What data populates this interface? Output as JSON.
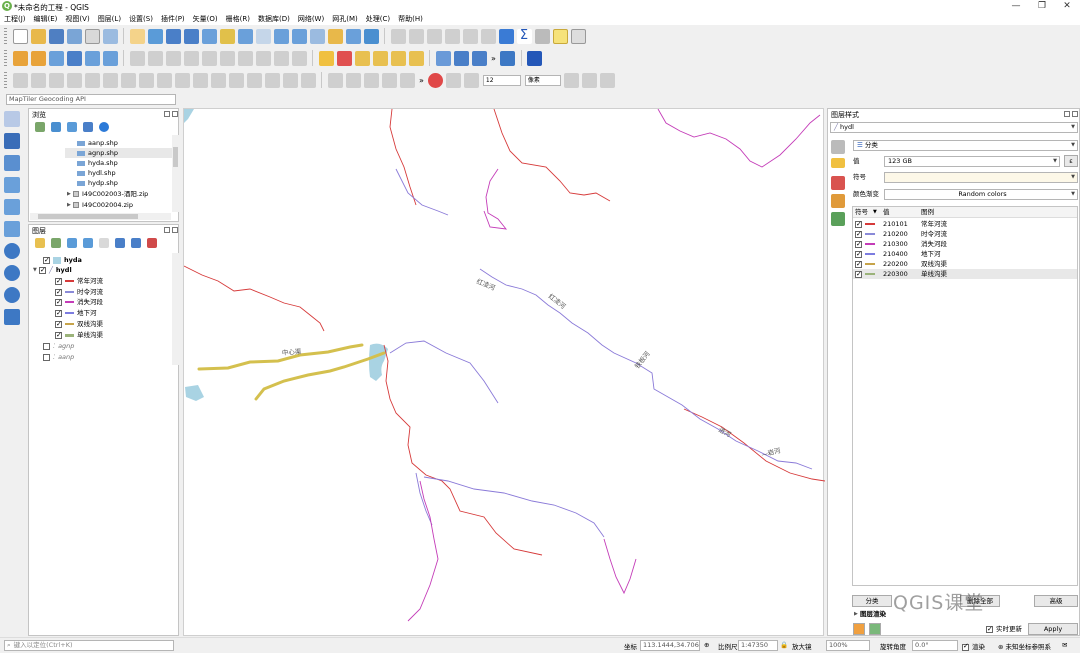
{
  "window": {
    "title": "*未命名的工程 - QGIS",
    "minimize": "—",
    "restore": "❐",
    "close": "✕"
  },
  "menu": [
    "工程(J)",
    "编辑(E)",
    "视图(V)",
    "图层(L)",
    "设置(S)",
    "插件(P)",
    "矢量(O)",
    "栅格(R)",
    "数据库(D)",
    "网络(W)",
    "网孔(M)",
    "处理(C)",
    "帮助(H)"
  ],
  "toolbar": {
    "scale_value": "12",
    "unit": "像素",
    "more": "»"
  },
  "locator_top": {
    "placeholder": "MapTiler Geocoding API"
  },
  "browser": {
    "title": "浏览",
    "items": [
      "aanp.shp",
      "agnp.shp",
      "hyda.shp",
      "hydl.shp",
      "hydp.shp",
      "I49C002003-酒阳.zip",
      "I49C002004.zip"
    ]
  },
  "layers": {
    "title": "图层",
    "hyda": "hyda",
    "hydl": "hydl",
    "categories": [
      "常年河流",
      "时令河流",
      "消失河段",
      "地下河",
      "双线沟渠",
      "单线沟渠"
    ],
    "agnp": "agnp",
    "aanp": "aanp"
  },
  "style": {
    "title": "图层样式",
    "layer": "hydl",
    "renderer": "分类",
    "value_label": "值",
    "value": "123 GB",
    "symbol_label": "符号",
    "ramp_label": "颜色渐变",
    "ramp": "Random colors",
    "col_symbol": "符号",
    "col_value": "值",
    "col_legend": "图例",
    "rows": [
      {
        "value": "210101",
        "legend": "常年河流",
        "color": "#d63a3a"
      },
      {
        "value": "210200",
        "legend": "时令河流",
        "color": "#8a8ad8"
      },
      {
        "value": "210300",
        "legend": "消失河段",
        "color": "#c43cb8"
      },
      {
        "value": "210400",
        "legend": "地下河",
        "color": "#7c7ce0"
      },
      {
        "value": "220200",
        "legend": "双线沟渠",
        "color": "#c7a44a"
      },
      {
        "value": "220300",
        "legend": "单线沟渠",
        "color": "#9bb37a"
      }
    ],
    "classify_btn": "分类",
    "delete_all_btn": "删除全部",
    "advanced_btn": "高级",
    "layer_render": "图层渲染",
    "live_update": "实时更新",
    "apply": "Apply"
  },
  "map": {
    "labels": [
      "红凌河",
      "红凌河",
      "铁板河",
      "进河",
      "—岩河",
      "中心渠"
    ]
  },
  "status": {
    "locator_placeholder": "键入以定位(Ctrl+K)",
    "coord_label": "坐标",
    "coord_value": "113.1444,34.7063",
    "scale_label": "比例尺",
    "scale_value": "1:47350",
    "magnifier_label": "放大镜",
    "magnifier_value": "100%",
    "rotation_label": "旋转角度",
    "rotation_value": "0.0°",
    "render_label": "渲染",
    "crs_label": "未知坐标参照系"
  },
  "watermark": "QGIS课堂",
  "colors": {
    "water": "#a9d3e3",
    "river_red": "#d63a3a",
    "river_purple": "#8a7ad8",
    "river_magenta": "#c43cb8",
    "canal": "#d4c04e"
  }
}
